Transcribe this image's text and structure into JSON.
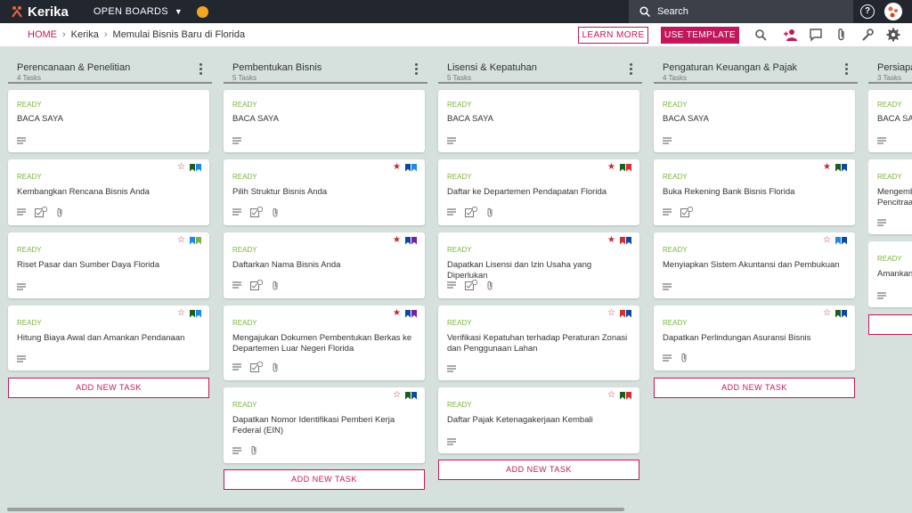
{
  "app": {
    "name": "Kerika",
    "open_boards": "OPEN BOARDS",
    "search_placeholder": "Search"
  },
  "breadcrumb": {
    "home": "HOME",
    "team": "Kerika",
    "board": "Memulai Bisnis Baru di Florida"
  },
  "actions": {
    "learn_more": "LEARN MORE",
    "use_template": "USE TEMPLATE"
  },
  "icons": [
    "search-icon",
    "add-person-icon",
    "chat-icon",
    "attachment-icon",
    "wrench-icon",
    "gear-icon"
  ],
  "add_task_label": "ADD NEW TASK",
  "columns": [
    {
      "title": "Perencanaan & Penelitian",
      "count": "4 Tasks",
      "cards": [
        {
          "status": "READY",
          "title": "BACA SAYA"
        },
        {
          "status": "READY",
          "title": "Kembangkan Rencana Bisnis Anda"
        },
        {
          "status": "READY",
          "title": "Riset Pasar dan Sumber Daya Florida"
        },
        {
          "status": "READY",
          "title": "Hitung Biaya Awal dan Amankan Pendanaan"
        }
      ]
    },
    {
      "title": "Pembentukan Bisnis",
      "count": "5 Tasks",
      "cards": [
        {
          "status": "READY",
          "title": "BACA SAYA"
        },
        {
          "status": "READY",
          "title": "Pilih Struktur Bisnis Anda"
        },
        {
          "status": "READY",
          "title": "Daftarkan Nama Bisnis Anda"
        },
        {
          "status": "READY",
          "title": "Mengajukan Dokumen Pembentukan Berkas ke Departemen Luar Negeri Florida"
        },
        {
          "status": "READY",
          "title": "Dapatkan Nomor Identifikasi Pemberi Kerja Federal (EIN)"
        }
      ]
    },
    {
      "title": "Lisensi & Kepatuhan",
      "count": "5 Tasks",
      "cards": [
        {
          "status": "READY",
          "title": "BACA SAYA"
        },
        {
          "status": "READY",
          "title": "Daftar ke Departemen Pendapatan Florida"
        },
        {
          "status": "READY",
          "title": "Dapatkan Lisensi dan Izin Usaha yang Diperlukan"
        },
        {
          "status": "READY",
          "title": "Verifikasi Kepatuhan terhadap Peraturan Zonasi dan Penggunaan Lahan"
        },
        {
          "status": "READY",
          "title": "Daftar Pajak Ketenagakerjaan Kembali"
        }
      ]
    },
    {
      "title": "Pengaturan Keuangan & Pajak",
      "count": "4 Tasks",
      "cards": [
        {
          "status": "READY",
          "title": "BACA SAYA"
        },
        {
          "status": "READY",
          "title": "Buka Rekening Bank Bisnis Florida"
        },
        {
          "status": "READY",
          "title": "Menyiapkan Sistem Akuntansi dan Pembukuan"
        },
        {
          "status": "READY",
          "title": "Dapatkan Perlindungan Asuransi Bisnis"
        }
      ]
    },
    {
      "title": "Persiapa",
      "count": "3 Tasks",
      "cards": [
        {
          "status": "READY",
          "title": "BACA SA"
        },
        {
          "status": "READY",
          "title": "Mengemb Pencitraa"
        },
        {
          "status": "READY",
          "title": "Amankan"
        }
      ]
    }
  ],
  "colors": {
    "accent": "#c2185b",
    "ready": "#7cb342",
    "topbar": "#22262e",
    "board_bg": "#d6e0dc"
  }
}
